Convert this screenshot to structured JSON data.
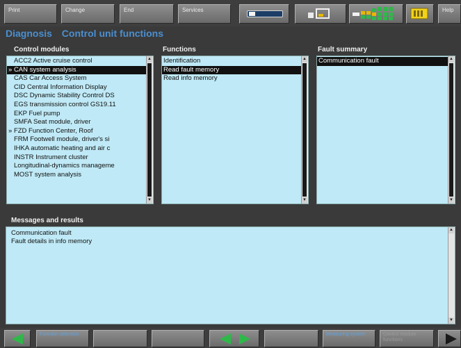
{
  "toolbar": {
    "print_label": "Print",
    "change_label": "Change",
    "end_label": "End",
    "services_label": "Services",
    "help_label": "Help"
  },
  "header": {
    "section": "Diagnosis",
    "title": "Control unit functions"
  },
  "control_modules": {
    "label": "Control modules",
    "items": [
      "ACC2 Active cruise control",
      "CAN system analysis",
      "CAS Car Access System",
      "CID Central Information Display",
      "DSC Dynamic Stability Control DS",
      "EGS transmission control GS19.11",
      "EKP Fuel pump",
      "SMFA Seat module, driver",
      "FZD Function Center, Roof",
      "FRM Footwell module, driver's si",
      "IHKA automatic heating and air c",
      "INSTR Instrument cluster",
      "Longitudinal-dynamics manageme",
      "MOST system analysis"
    ]
  },
  "functions": {
    "label": "Functions",
    "items": [
      "Identification",
      "Read fault memory",
      "Read info memory"
    ]
  },
  "fault_summary": {
    "label": "Fault summary",
    "items": [
      "Communication fault"
    ]
  },
  "messages": {
    "label": "Messages and results",
    "lines": [
      "Communication fault",
      "Fault details in info memory"
    ]
  },
  "bottombar": {
    "function_selection_label": "Function selection",
    "measuring_system_label": "Measuring system",
    "control_module_functions_label": "Control module functions"
  }
}
